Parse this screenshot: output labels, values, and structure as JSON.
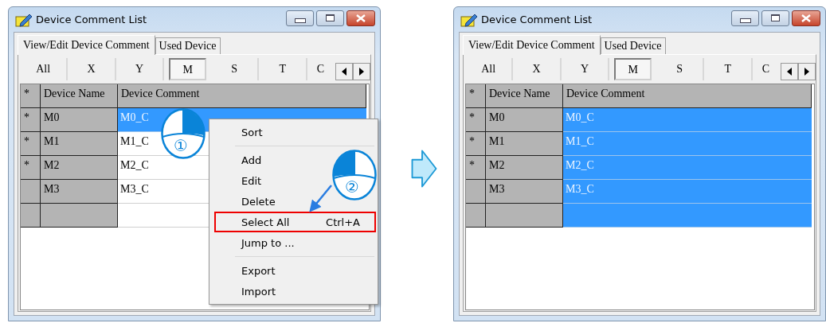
{
  "panels": [
    {
      "window": {
        "title": "Device Comment List"
      },
      "tabs": [
        {
          "label": "View/Edit Device Comment",
          "selected": true
        },
        {
          "label": "Used Device",
          "selected": false
        }
      ],
      "device_types": [
        {
          "label": "All",
          "selected": false
        },
        {
          "label": "X",
          "selected": false
        },
        {
          "label": "Y",
          "selected": false
        },
        {
          "label": "M",
          "selected": true
        },
        {
          "label": "S",
          "selected": false
        },
        {
          "label": "T",
          "selected": false
        },
        {
          "label": "C",
          "selected": false
        }
      ],
      "table": {
        "columns": [
          "*",
          "Device Name",
          "Device Comment"
        ],
        "rows": [
          {
            "mark": "*",
            "name": "M0",
            "comment": "M0_C",
            "selected": true
          },
          {
            "mark": "*",
            "name": "M1",
            "comment": "M1_C",
            "selected": false
          },
          {
            "mark": "*",
            "name": "M2",
            "comment": "M2_C",
            "selected": false
          },
          {
            "name": "M3",
            "comment": "M3_C",
            "selected": false
          },
          {
            "selected": false
          }
        ]
      },
      "context_menu": {
        "items": [
          {
            "kind": "item",
            "label": "Sort",
            "highlighted": false
          },
          {
            "kind": "separator"
          },
          {
            "kind": "item",
            "label": "Add",
            "highlighted": false
          },
          {
            "kind": "item",
            "label": "Edit",
            "highlighted": false
          },
          {
            "kind": "item",
            "label": "Delete",
            "highlighted": false
          },
          {
            "kind": "item",
            "label": "Select All",
            "shortcut": "Ctrl+A",
            "highlighted": true
          },
          {
            "kind": "item",
            "label": "Jump to ...",
            "highlighted": false
          },
          {
            "kind": "separator"
          },
          {
            "kind": "item",
            "label": "Export",
            "highlighted": false
          },
          {
            "kind": "item",
            "label": "Import",
            "highlighted": false
          }
        ]
      },
      "callouts": [
        {
          "number": "①",
          "kind": "right"
        },
        {
          "number": "②",
          "kind": "left",
          "arrow": true
        }
      ]
    },
    {
      "window": {
        "title": "Device Comment List"
      },
      "tabs": [
        {
          "label": "View/Edit Device Comment",
          "selected": true
        },
        {
          "label": "Used Device",
          "selected": false
        }
      ],
      "device_types": [
        {
          "label": "All",
          "selected": false
        },
        {
          "label": "X",
          "selected": false
        },
        {
          "label": "Y",
          "selected": false
        },
        {
          "label": "M",
          "selected": true
        },
        {
          "label": "S",
          "selected": false
        },
        {
          "label": "T",
          "selected": false
        },
        {
          "label": "C",
          "selected": false
        }
      ],
      "table": {
        "columns": [
          "*",
          "Device Name",
          "Device Comment"
        ],
        "rows": [
          {
            "mark": "*",
            "name": "M0",
            "comment": "M0_C",
            "selected": true
          },
          {
            "mark": "*",
            "name": "M1",
            "comment": "M1_C",
            "selected": true
          },
          {
            "mark": "*",
            "name": "M2",
            "comment": "M2_C",
            "selected": true
          },
          {
            "name": "M3",
            "comment": "M3_C",
            "selected": true
          },
          {
            "selected": true
          }
        ]
      }
    }
  ]
}
